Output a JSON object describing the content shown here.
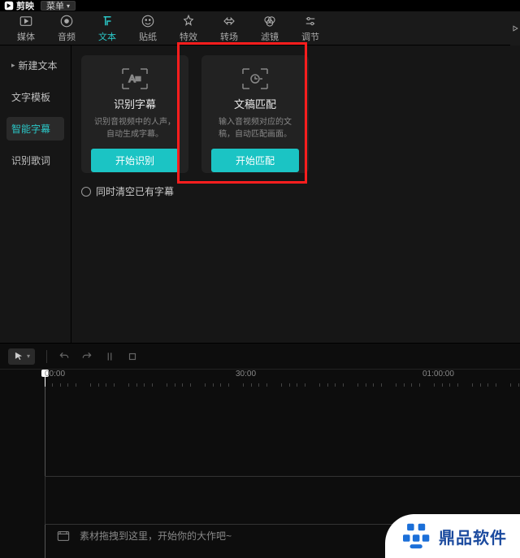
{
  "titlebar": {
    "app_name": "剪映",
    "menu_label": "菜单"
  },
  "tabs": [
    {
      "id": "media",
      "label": "媒体"
    },
    {
      "id": "audio",
      "label": "音频"
    },
    {
      "id": "text",
      "label": "文本"
    },
    {
      "id": "sticker",
      "label": "贴纸"
    },
    {
      "id": "effect",
      "label": "特效"
    },
    {
      "id": "transition",
      "label": "转场"
    },
    {
      "id": "filter",
      "label": "滤镜"
    },
    {
      "id": "adjust",
      "label": "调节"
    }
  ],
  "sidebar": {
    "items": [
      {
        "label": "新建文本",
        "expandable": true
      },
      {
        "label": "文字模板"
      },
      {
        "label": "智能字幕",
        "active": true
      },
      {
        "label": "识别歌词"
      }
    ]
  },
  "cards": [
    {
      "title": "识别字幕",
      "desc": "识别音视频中的人声，自动生成字幕。",
      "button": "开始识别"
    },
    {
      "title": "文稿匹配",
      "desc": "输入音视频对应的文稿，自动匹配画面。",
      "button": "开始匹配"
    }
  ],
  "checkbox_label": "同时清空已有字幕",
  "ruler": {
    "marks": [
      "00:00",
      "30:00",
      "01:00:00"
    ]
  },
  "drop_hint": "素材拖拽到这里，开始你的大作吧~",
  "watermark": "鼎品软件"
}
